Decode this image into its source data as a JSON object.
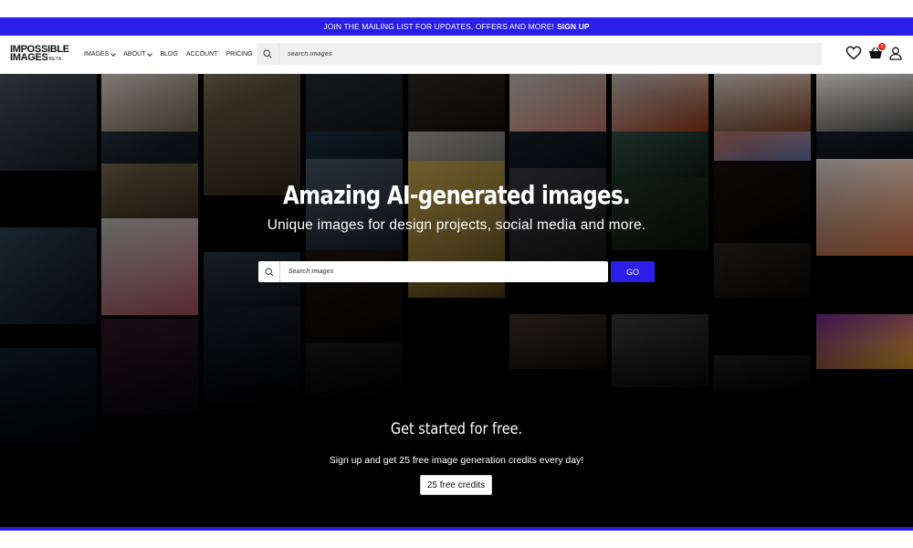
{
  "banner": {
    "text": "JOIN THE MAILING LIST FOR UPDATES, OFFERS AND MORE!",
    "link": "SIGN UP"
  },
  "logo": {
    "line1": "IMPOSSIBLE",
    "line2": "IMAGES",
    "beta": "BETA"
  },
  "nav": {
    "items": [
      {
        "label": "IMAGES",
        "dropdown": true
      },
      {
        "label": "ABOUT",
        "dropdown": true
      },
      {
        "label": "BLOG",
        "dropdown": false
      },
      {
        "label": "ACCOUNT",
        "dropdown": false
      },
      {
        "label": "PRICING",
        "dropdown": false
      }
    ],
    "search_placeholder": "search images",
    "cart_count": "0"
  },
  "hero": {
    "title": "Amazing AI-generated images.",
    "subtitle": "Unique images for design projects, social media and more.",
    "search_placeholder": "Search images",
    "go_label": "GO"
  },
  "cta": {
    "title": "Get started for free.",
    "text": "Sign up and get 25 free image generation credits every day!",
    "button": "25 free credits"
  },
  "colors": {
    "accent": "#2a1ee8",
    "background": "#000000"
  }
}
